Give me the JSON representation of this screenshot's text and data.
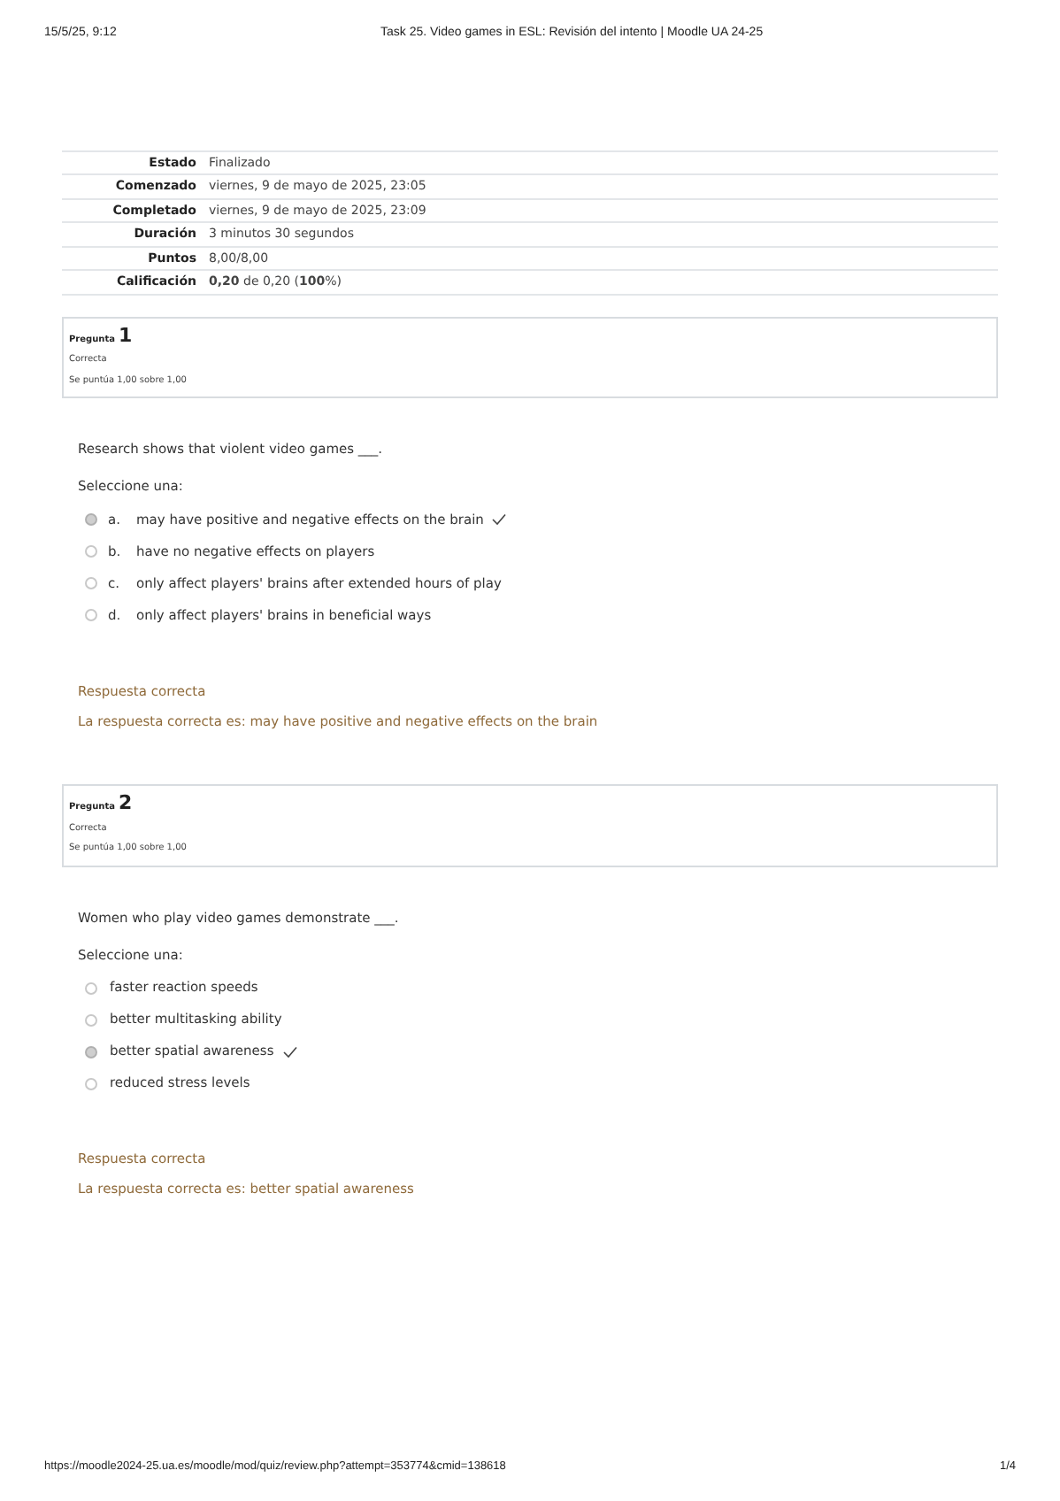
{
  "print_header": {
    "date": "15/5/25, 9:12",
    "title": "Task 25. Video games in ESL: Revisión del intento | Moodle UA 24-25"
  },
  "summary": [
    {
      "label": "Estado",
      "value": "Finalizado"
    },
    {
      "label": "Comenzado",
      "value": "viernes, 9 de mayo de 2025, 23:05"
    },
    {
      "label": "Completado",
      "value": "viernes, 9 de mayo de 2025, 23:09"
    },
    {
      "label": "Duración",
      "value": "3 minutos 30 segundos"
    },
    {
      "label": "Puntos",
      "value": "8,00/8,00"
    },
    {
      "label": "Calificación",
      "value": "**0,20** de 0,20 (**100**%)"
    }
  ],
  "questions": [
    {
      "label": "Pregunta",
      "number": "1",
      "state": "Correcta",
      "grade": "Se puntúa 1,00 sobre 1,00",
      "prompt": "Research shows that violent video games ___.",
      "instruction": "Seleccione una:",
      "options": [
        {
          "letter": "a.",
          "text": "may have positive and negative effects on the brain",
          "selected": true
        },
        {
          "letter": "b.",
          "text": "have no negative effects on players",
          "selected": false
        },
        {
          "letter": "c.",
          "text": "only affect players' brains after extended hours of play",
          "selected": false
        },
        {
          "letter": "d.",
          "text": "only affect players' brains in beneficial ways",
          "selected": false
        }
      ],
      "feedback": "Respuesta correcta",
      "right_answer": "La respuesta correcta es: may have positive and negative effects on the brain"
    },
    {
      "label": "Pregunta",
      "number": "2",
      "state": "Correcta",
      "grade": "Se puntúa 1,00 sobre 1,00",
      "prompt": "Women who play video games demonstrate ___.",
      "instruction": "Seleccione una:",
      "options": [
        {
          "text": "faster reaction speeds",
          "selected": false
        },
        {
          "text": "better multitasking ability",
          "selected": false
        },
        {
          "text": "better spatial awareness",
          "selected": true
        },
        {
          "text": "reduced stress levels",
          "selected": false
        }
      ],
      "feedback": "Respuesta correcta",
      "right_answer": "La respuesta correcta es: better spatial awareness"
    }
  ],
  "print_footer": {
    "url": "https://moodle2024-25.ua.es/moodle/mod/quiz/review.php?attempt=353774&cmid=138618",
    "page": "1/4"
  }
}
